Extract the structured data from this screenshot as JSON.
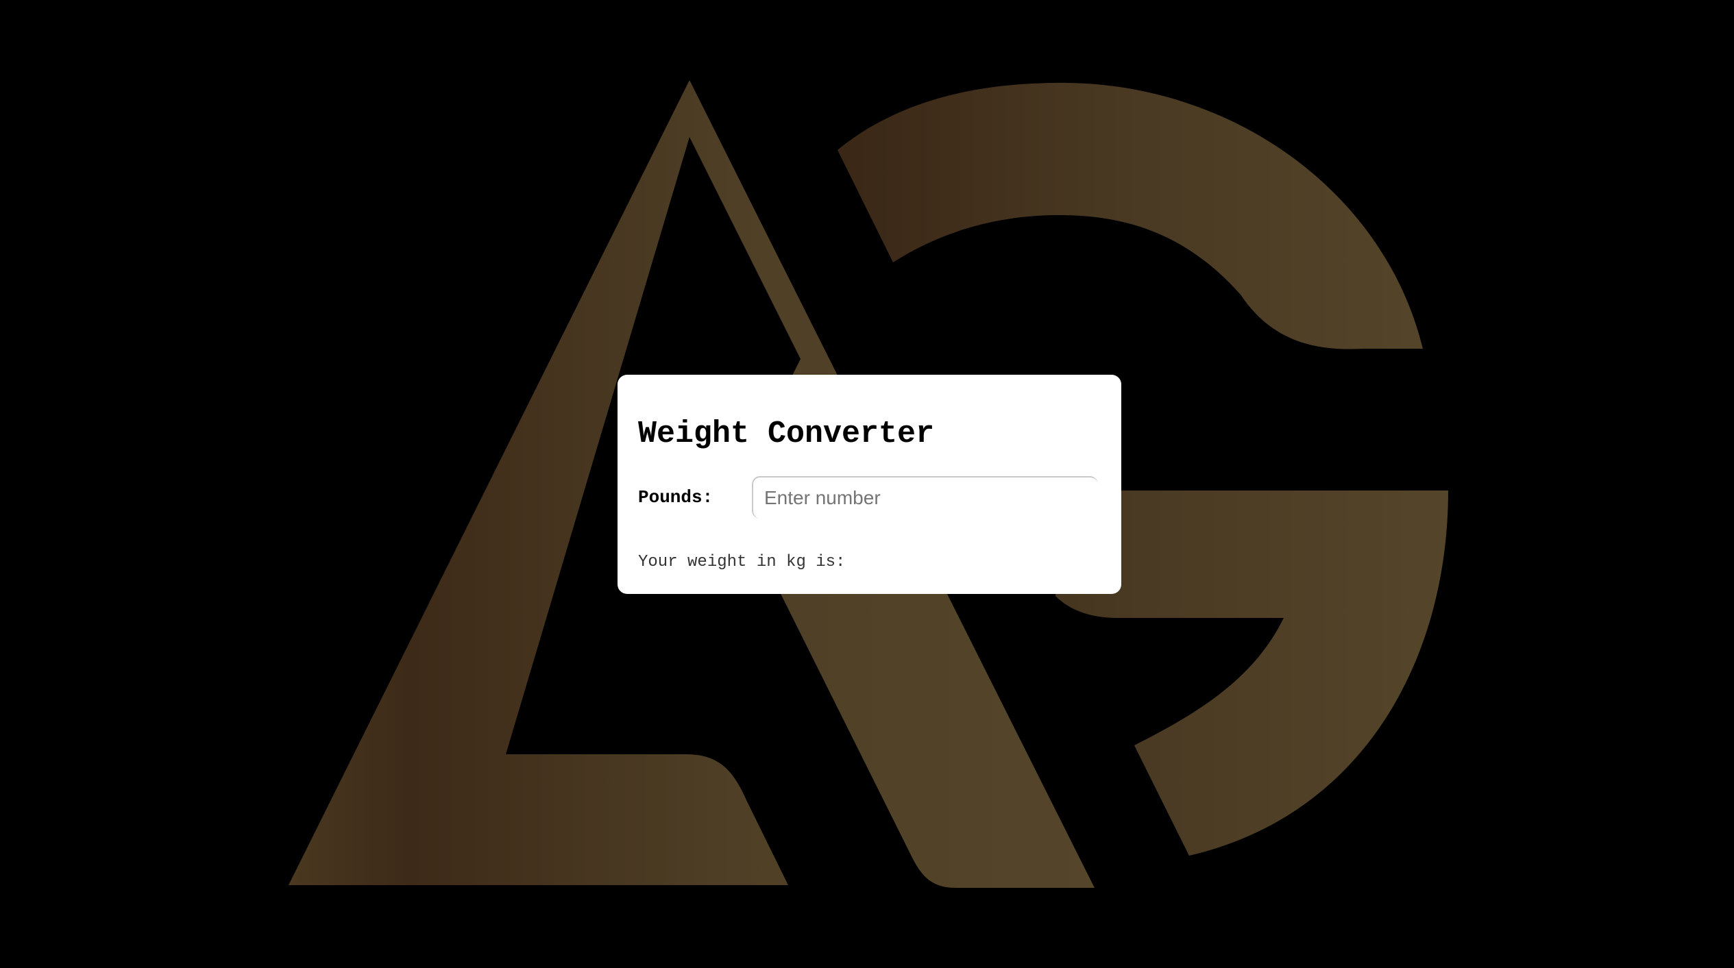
{
  "background": {
    "color": "#000000",
    "logo_letters": "AG",
    "logo_gradient": [
      "#3d2a18",
      "#4f3f26",
      "#55452a"
    ]
  },
  "converter": {
    "title": "Weight Converter",
    "pounds_label": "Pounds:",
    "pounds_placeholder": "Enter number",
    "pounds_value": "",
    "result_text": "Your weight in kg is:"
  }
}
